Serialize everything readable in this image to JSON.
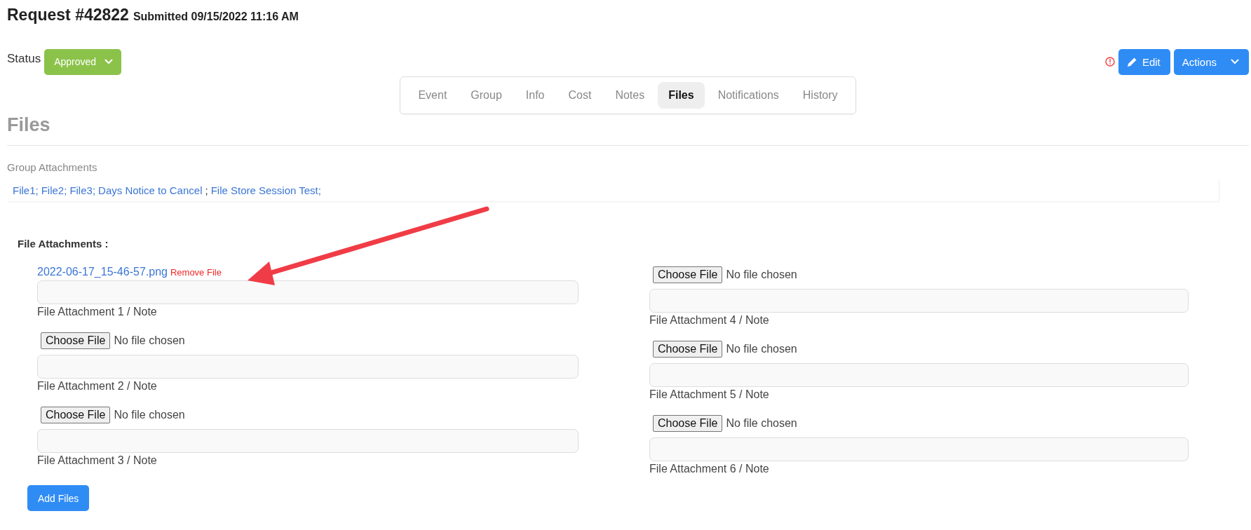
{
  "header": {
    "title": "Request #42822",
    "submitted": "Submitted 09/15/2022 11:16 AM"
  },
  "status": {
    "label": "Status",
    "value": "Approved"
  },
  "buttons": [
    {
      "kind": "edit",
      "label": "Edit"
    },
    {
      "kind": "dropdown",
      "label": "Actions"
    }
  ],
  "tabs": [
    {
      "label": "Event",
      "selected": false
    },
    {
      "label": "Group",
      "selected": false
    },
    {
      "label": "Info",
      "selected": false
    },
    {
      "label": "Cost",
      "selected": false
    },
    {
      "label": "Notes",
      "selected": false
    },
    {
      "label": "Files",
      "selected": true
    },
    {
      "label": "Notifications",
      "selected": false
    },
    {
      "label": "History",
      "selected": false
    }
  ],
  "section": {
    "title": "Files"
  },
  "group_attachments": {
    "label": "Group Attachments",
    "parts": [
      {
        "kind": "link",
        "text": "File1;"
      },
      {
        "kind": "link",
        "text": "File2;"
      },
      {
        "kind": "link",
        "text": "File3;"
      },
      {
        "kind": "link",
        "text": "Days Notice to Cancel"
      },
      {
        "kind": "plain",
        "text": ";"
      },
      {
        "kind": "link",
        "text": "File Store Session Test;"
      }
    ]
  },
  "file_attachments": {
    "title": "File Attachments :",
    "add_button": "Add Files",
    "columns": [
      [
        {
          "kind": "existing",
          "file": "2022-06-17_15-46-57.png",
          "remove": "Remove File",
          "label": "File Attachment 1 / Note"
        },
        {
          "kind": "empty",
          "choose": "Choose File",
          "status": "No file chosen",
          "label": "File Attachment 2 / Note"
        },
        {
          "kind": "empty",
          "choose": "Choose File",
          "status": "No file chosen",
          "label": "File Attachment 3 / Note"
        }
      ],
      [
        {
          "kind": "empty",
          "choose": "Choose File",
          "status": "No file chosen",
          "label": "File Attachment 4 / Note"
        },
        {
          "kind": "empty",
          "choose": "Choose File",
          "status": "No file chosen",
          "label": "File Attachment 5 / Note"
        },
        {
          "kind": "empty",
          "choose": "Choose File",
          "status": "No file chosen",
          "label": "File Attachment 6 / Note"
        }
      ]
    ]
  }
}
